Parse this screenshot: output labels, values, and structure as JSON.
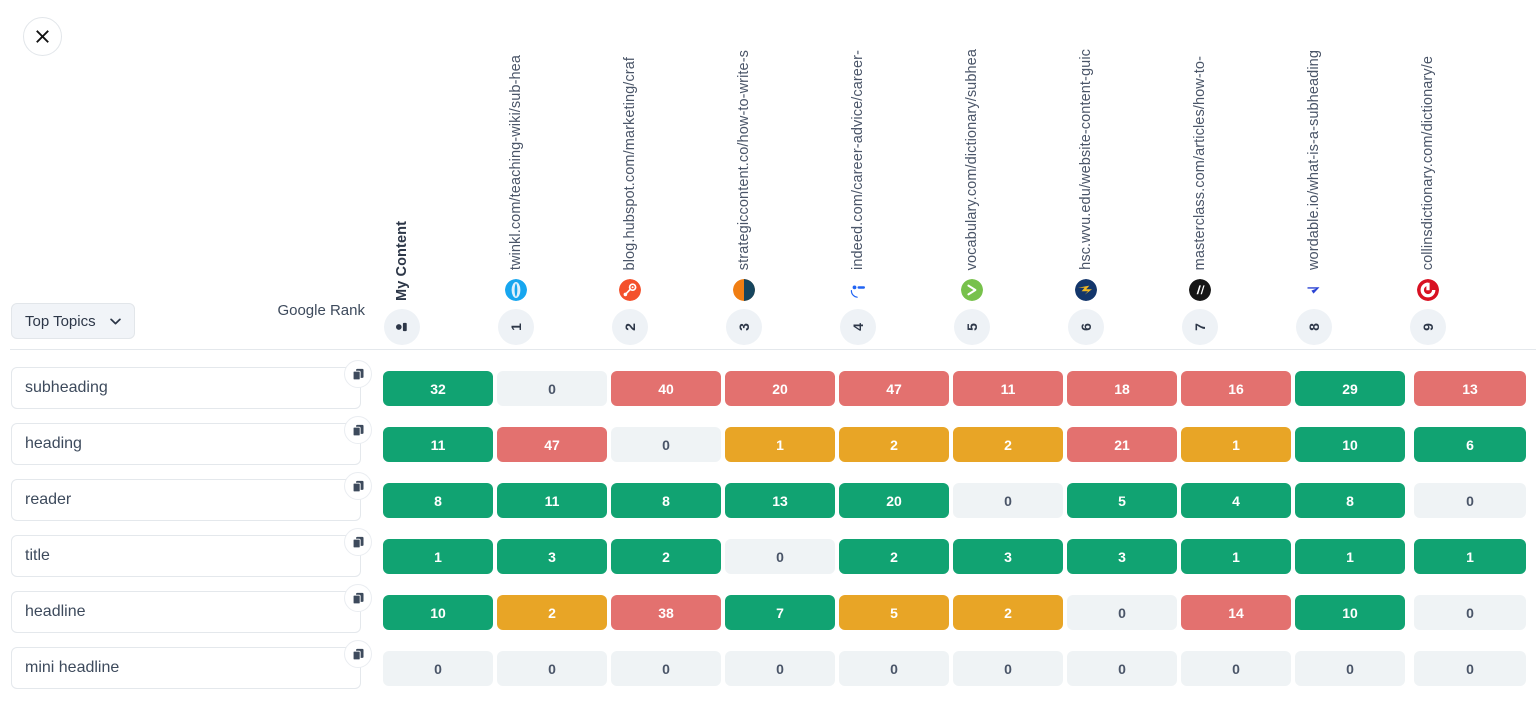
{
  "close_button": {
    "icon": "close-icon"
  },
  "controls": {
    "topics_dropdown": {
      "label": "Top Topics",
      "icon": "chevron-down-icon"
    },
    "google_rank_label": "Google Rank"
  },
  "columns": [
    {
      "url": "My Content",
      "rank": "",
      "favicon": "my-content-icon",
      "is_my_content": true
    },
    {
      "url": "twinkl.com/teaching-wiki/sub-hea",
      "rank": "1",
      "favicon": "twinkl-favicon"
    },
    {
      "url": "blog.hubspot.com/marketing/craf",
      "rank": "2",
      "favicon": "hubspot-favicon"
    },
    {
      "url": "strategiccontent.co/how-to-write-s",
      "rank": "3",
      "favicon": "strategiccontent-favicon"
    },
    {
      "url": "indeed.com/career-advice/career-",
      "rank": "4",
      "favicon": "indeed-favicon"
    },
    {
      "url": "vocabulary.com/dictionary/subhea",
      "rank": "5",
      "favicon": "vocabulary-favicon"
    },
    {
      "url": "hsc.wvu.edu/website-content-guic",
      "rank": "6",
      "favicon": "wvu-favicon"
    },
    {
      "url": "masterclass.com/articles/how-to-",
      "rank": "7",
      "favicon": "masterclass-favicon"
    },
    {
      "url": "wordable.io/what-is-a-subheading",
      "rank": "8",
      "favicon": "wordable-favicon"
    },
    {
      "url": "collinsdictionary.com/dictionary/e",
      "rank": "9",
      "favicon": "collins-favicon"
    }
  ],
  "rows": [
    {
      "keyword": "subheading",
      "cells": [
        {
          "value": "32",
          "state": "green"
        },
        {
          "value": "0",
          "state": "zero"
        },
        {
          "value": "40",
          "state": "red"
        },
        {
          "value": "20",
          "state": "red"
        },
        {
          "value": "47",
          "state": "red"
        },
        {
          "value": "11",
          "state": "red"
        },
        {
          "value": "18",
          "state": "red"
        },
        {
          "value": "16",
          "state": "red"
        },
        {
          "value": "29",
          "state": "green"
        },
        {
          "value": "13",
          "state": "red"
        }
      ]
    },
    {
      "keyword": "heading",
      "cells": [
        {
          "value": "11",
          "state": "green"
        },
        {
          "value": "47",
          "state": "red"
        },
        {
          "value": "0",
          "state": "zero"
        },
        {
          "value": "1",
          "state": "amber"
        },
        {
          "value": "2",
          "state": "amber"
        },
        {
          "value": "2",
          "state": "amber"
        },
        {
          "value": "21",
          "state": "red"
        },
        {
          "value": "1",
          "state": "amber"
        },
        {
          "value": "10",
          "state": "green"
        },
        {
          "value": "6",
          "state": "green"
        }
      ]
    },
    {
      "keyword": "reader",
      "cells": [
        {
          "value": "8",
          "state": "green"
        },
        {
          "value": "11",
          "state": "green"
        },
        {
          "value": "8",
          "state": "green"
        },
        {
          "value": "13",
          "state": "green"
        },
        {
          "value": "20",
          "state": "green"
        },
        {
          "value": "0",
          "state": "zero"
        },
        {
          "value": "5",
          "state": "green"
        },
        {
          "value": "4",
          "state": "green"
        },
        {
          "value": "8",
          "state": "green"
        },
        {
          "value": "0",
          "state": "zero"
        }
      ]
    },
    {
      "keyword": "title",
      "cells": [
        {
          "value": "1",
          "state": "green"
        },
        {
          "value": "3",
          "state": "green"
        },
        {
          "value": "2",
          "state": "green"
        },
        {
          "value": "0",
          "state": "zero"
        },
        {
          "value": "2",
          "state": "green"
        },
        {
          "value": "3",
          "state": "green"
        },
        {
          "value": "3",
          "state": "green"
        },
        {
          "value": "1",
          "state": "green"
        },
        {
          "value": "1",
          "state": "green"
        },
        {
          "value": "1",
          "state": "green"
        }
      ]
    },
    {
      "keyword": "headline",
      "cells": [
        {
          "value": "10",
          "state": "green"
        },
        {
          "value": "2",
          "state": "amber"
        },
        {
          "value": "38",
          "state": "red"
        },
        {
          "value": "7",
          "state": "green"
        },
        {
          "value": "5",
          "state": "amber"
        },
        {
          "value": "2",
          "state": "amber"
        },
        {
          "value": "0",
          "state": "zero"
        },
        {
          "value": "14",
          "state": "red"
        },
        {
          "value": "10",
          "state": "green"
        },
        {
          "value": "0",
          "state": "zero"
        }
      ]
    },
    {
      "keyword": "mini headline",
      "cells": [
        {
          "value": "0",
          "state": "zero"
        },
        {
          "value": "0",
          "state": "zero"
        },
        {
          "value": "0",
          "state": "zero"
        },
        {
          "value": "0",
          "state": "zero"
        },
        {
          "value": "0",
          "state": "zero"
        },
        {
          "value": "0",
          "state": "zero"
        },
        {
          "value": "0",
          "state": "zero"
        },
        {
          "value": "0",
          "state": "zero"
        },
        {
          "value": "0",
          "state": "zero"
        },
        {
          "value": "0",
          "state": "zero"
        }
      ]
    }
  ],
  "colors": {
    "green": "#11a372",
    "red": "#e3716f",
    "amber": "#e8a526",
    "zero": "#eff3f5"
  }
}
